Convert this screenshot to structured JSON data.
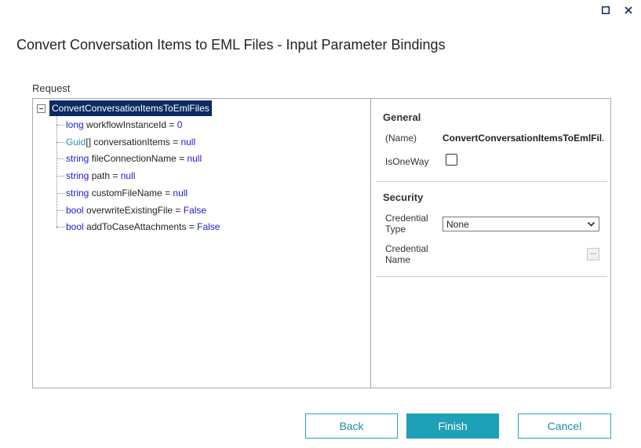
{
  "dialog": {
    "title": "Convert Conversation Items to EML Files - Input Parameter Bindings",
    "section_label": "Request"
  },
  "tree": {
    "root_label": "ConvertConversationItemsToEmlFiles",
    "items": [
      {
        "type": "long",
        "type_class": "kw",
        "name": "workflowInstanceId",
        "eq": " = ",
        "value": "0"
      },
      {
        "type": "Guid",
        "type_class": "ty",
        "suffix": "[]",
        "name": "conversationItems",
        "eq": " = ",
        "value": "null"
      },
      {
        "type": "string",
        "type_class": "kw",
        "name": "fileConnectionName",
        "eq": " = ",
        "value": "null"
      },
      {
        "type": "string",
        "type_class": "kw",
        "name": "path",
        "eq": " = ",
        "value": "null"
      },
      {
        "type": "string",
        "type_class": "kw",
        "name": "customFileName",
        "eq": " = ",
        "value": "null"
      },
      {
        "type": "bool",
        "type_class": "kw",
        "name": "overwriteExistingFile",
        "eq": " = ",
        "value": "False"
      },
      {
        "type": "bool",
        "type_class": "kw",
        "name": "addToCaseAttachments",
        "eq": " = ",
        "value": "False"
      }
    ]
  },
  "properties": {
    "general_heading": "General",
    "name_label": "(Name)",
    "name_value": "ConvertConversationItemsToEmlFil...",
    "isoneway_label": "IsOneWay",
    "security_heading": "Security",
    "credential_type_label_1": "Credential",
    "credential_type_label_2": "Type",
    "credential_type_value": "None",
    "credential_name_label_1": "Credential",
    "credential_name_label_2": "Name",
    "ellipsis": "..."
  },
  "buttons": {
    "back": "Back",
    "finish": "Finish",
    "cancel": "Cancel"
  },
  "colors": {
    "accent": "#1ea0b6",
    "selection": "#0b2b63",
    "keyword": "#1a1ad6",
    "type": "#2b91af"
  }
}
